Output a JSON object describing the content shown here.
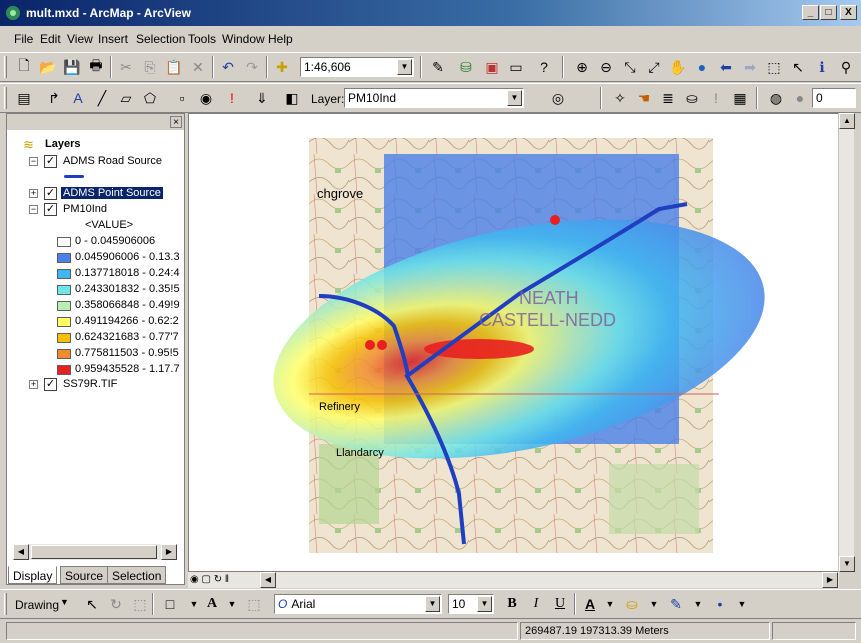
{
  "window": {
    "title": "mult.mxd - ArcMap - ArcView",
    "minimize": "_",
    "maximize": "□",
    "close": "X"
  },
  "menu": [
    "File",
    "Edit",
    "View",
    "Insert",
    "Selection",
    "Tools",
    "Window",
    "Help"
  ],
  "toolbar": {
    "scale": "1:46,606",
    "layer_label": "Layer:",
    "layer_value": "PM10Ind",
    "spinner_value": "0"
  },
  "toc": {
    "root": "Layers",
    "layers": [
      {
        "name": "ADMS Road Source",
        "checked": true,
        "expanded": true
      },
      {
        "name": "ADMS Point Source",
        "checked": true,
        "expanded": false
      },
      {
        "name": "PM10Ind",
        "checked": true,
        "expanded": true
      },
      {
        "name": "SS79R.TIF",
        "checked": true,
        "expanded": false
      }
    ],
    "value_header": "<VALUE>",
    "legend": [
      {
        "label": "0 - 0.045906006",
        "color": "#ffffff"
      },
      {
        "label": "0.045906006 - 0.13.3",
        "color": "#4a7fe8"
      },
      {
        "label": "0.137718018 - 0.24:4",
        "color": "#3fb8f0"
      },
      {
        "label": "0.243301832 - 0.35!5",
        "color": "#6fe6e6"
      },
      {
        "label": "0.358066848 - 0.49!9",
        "color": "#b9eeb0"
      },
      {
        "label": "0.491194266 - 0.62:2",
        "color": "#ffff66"
      },
      {
        "label": "0.624321683 - 0.77'7",
        "color": "#f5c000"
      },
      {
        "label": "0.775811503 - 0.95!5",
        "color": "#f08a30"
      },
      {
        "label": "0.959435528 - 1.17.7",
        "color": "#e82020"
      }
    ],
    "road_color": "#1f3fc0"
  },
  "tabs": [
    "Display",
    "Source",
    "Selection"
  ],
  "drawing": {
    "label": "Drawing",
    "font": "Arial",
    "size": "10",
    "bold": "B",
    "italic": "I",
    "underline": "U"
  },
  "map": {
    "labels": {
      "town1": "NEATH",
      "town2": "CASTELL-NEDD",
      "place1": "chgrove",
      "place2": "Llandarcy",
      "place3": "Refinery"
    }
  },
  "status": {
    "coords": "269487.19  197313.39 Meters"
  }
}
